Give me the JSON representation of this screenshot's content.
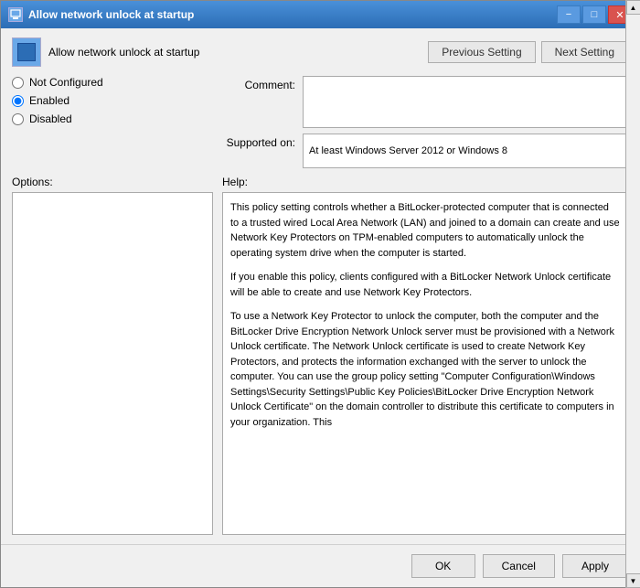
{
  "window": {
    "title": "Allow network unlock at startup",
    "icon": "settings-icon"
  },
  "header": {
    "policy_title": "Allow network unlock at startup",
    "prev_button": "Previous Setting",
    "next_button": "Next Setting"
  },
  "form": {
    "comment_label": "Comment:",
    "supported_label": "Supported on:",
    "supported_value": "At least Windows Server 2012 or Windows 8",
    "radio_options": [
      {
        "id": "not-configured",
        "label": "Not Configured",
        "selected": false
      },
      {
        "id": "enabled",
        "label": "Enabled",
        "selected": true
      },
      {
        "id": "disabled",
        "label": "Disabled",
        "selected": false
      }
    ]
  },
  "sections": {
    "options_label": "Options:",
    "help_label": "Help:",
    "help_text_1": "This policy setting controls whether a BitLocker-protected computer that is connected to a trusted wired Local Area Network (LAN) and joined to a domain can create and use Network Key Protectors on TPM-enabled computers to automatically unlock the operating system drive when the computer is started.",
    "help_text_2": "If you enable this policy, clients configured with a BitLocker Network Unlock certificate will be able to create and use Network Key Protectors.",
    "help_text_3": "To use a Network Key Protector to unlock the computer, both the computer and the BitLocker Drive Encryption Network Unlock server must be provisioned with a Network Unlock certificate. The Network Unlock certificate is used to create Network Key Protectors, and protects the information exchanged with the server to unlock the computer. You can use the group policy setting \"Computer Configuration\\Windows Settings\\Security Settings\\Public Key Policies\\BitLocker Drive Encryption Network Unlock Certificate\" on the domain controller to distribute this certificate to computers in your organization. This"
  },
  "buttons": {
    "ok": "OK",
    "cancel": "Cancel",
    "apply": "Apply"
  },
  "title_bar_buttons": {
    "minimize": "−",
    "maximize": "□",
    "close": "✕"
  }
}
